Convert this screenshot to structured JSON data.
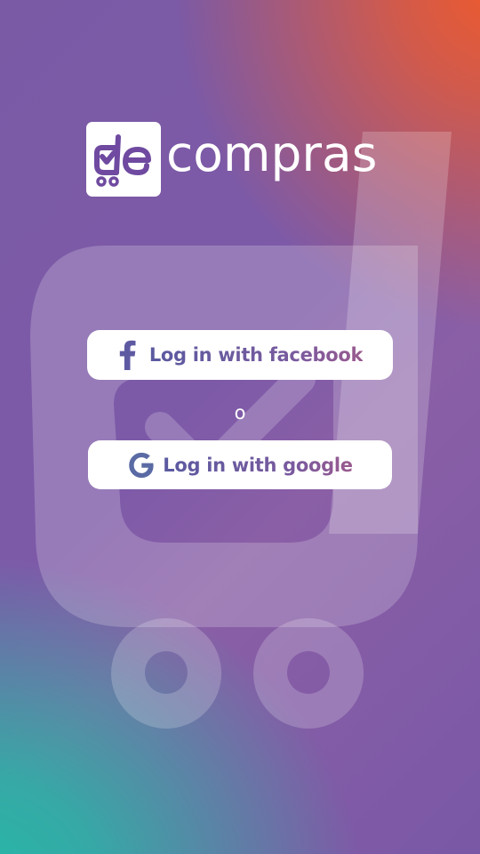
{
  "logo": {
    "brand_text": "compras",
    "mark_text": "de"
  },
  "login": {
    "facebook_label": "Log in with facebook",
    "separator": "o",
    "google_label": "Log in with google"
  },
  "icons": {
    "logo_mark": "cart-check-icon",
    "facebook": "facebook-icon",
    "google": "google-icon",
    "background": "shopping-cart-icon"
  },
  "colors": {
    "brand_purple": "#6f4aa0",
    "button_bg": "#ffffff",
    "text_white": "#ffffff",
    "gradient_orange": "#ee5a2c",
    "gradient_teal": "#22bba6",
    "gradient_purple": "#7a5aa5"
  }
}
